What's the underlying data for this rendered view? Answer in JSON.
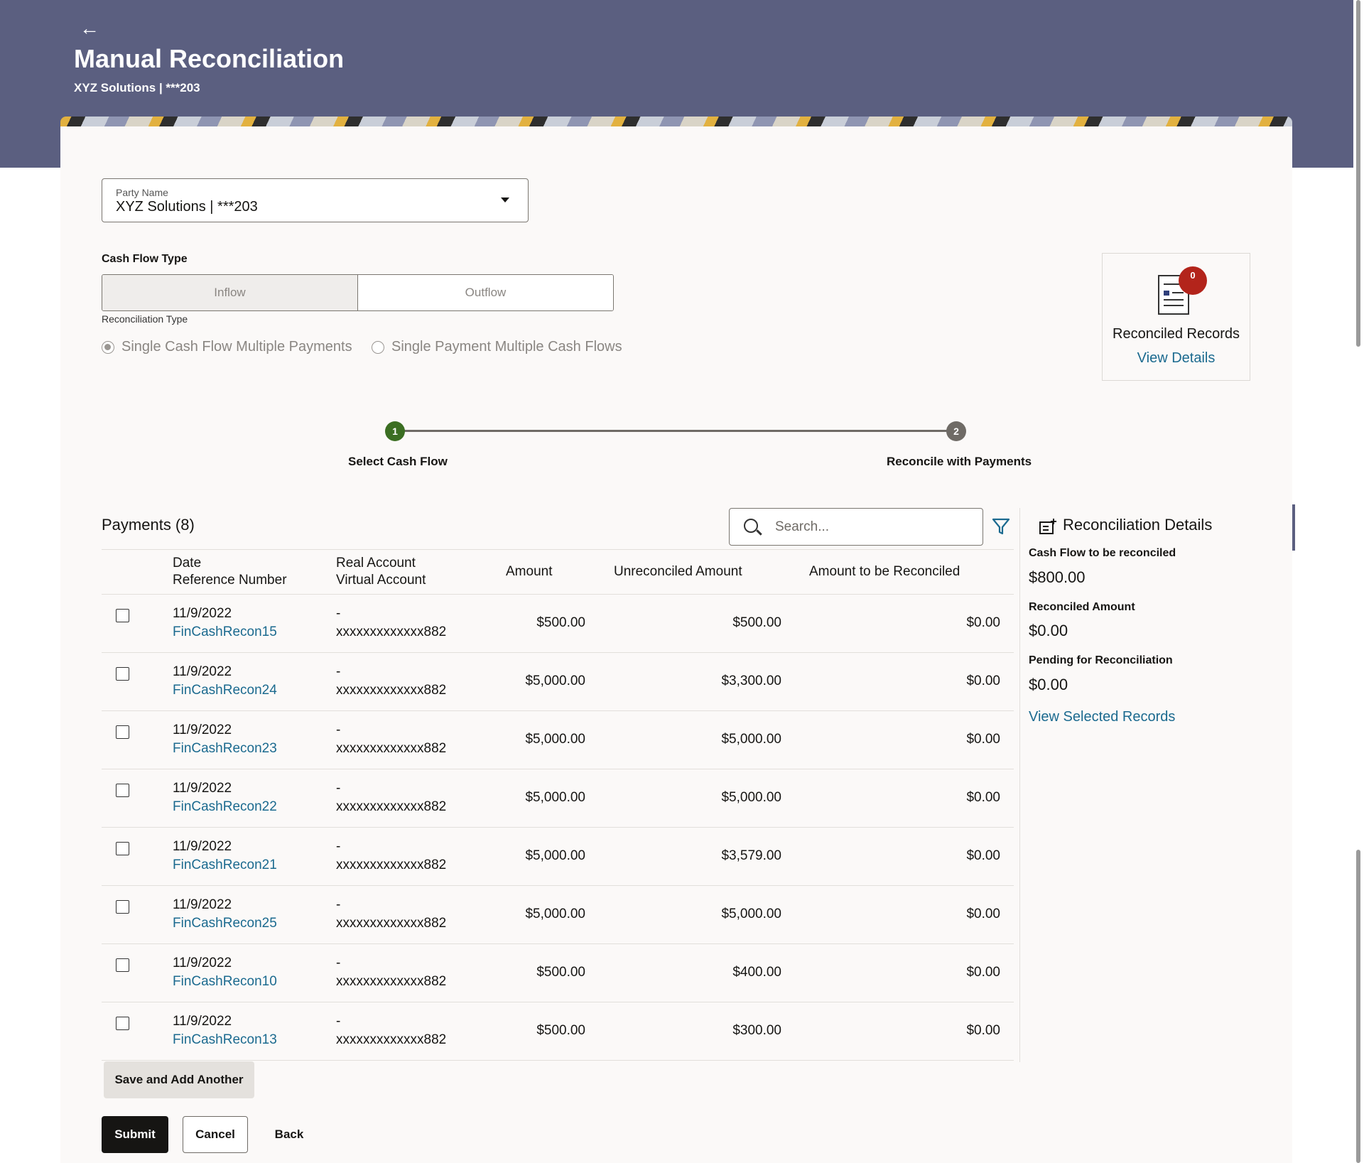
{
  "header": {
    "title": "Manual Reconciliation",
    "subtitle": "XYZ Solutions | ***203",
    "back_icon": "arrow-left-icon"
  },
  "party": {
    "label": "Party Name",
    "value": "XYZ Solutions | ***203"
  },
  "cash_flow_type": {
    "label": "Cash Flow Type",
    "options": [
      "Inflow",
      "Outflow"
    ],
    "selected": "Inflow"
  },
  "reconciliation_type": {
    "label": "Reconciliation Type",
    "options": [
      "Single Cash Flow Multiple Payments",
      "Single Payment Multiple Cash Flows"
    ],
    "selected": "Single Cash Flow Multiple Payments"
  },
  "reconciled_records": {
    "count": "0",
    "title": "Reconciled Records",
    "link": "View Details"
  },
  "stepper": {
    "steps": [
      {
        "number": "1",
        "label": "Select Cash Flow"
      },
      {
        "number": "2",
        "label": "Reconcile with Payments"
      }
    ],
    "active_color": "#3b6e22",
    "inactive_color": "#6f6b66"
  },
  "payments": {
    "title": "Payments (8)",
    "search_placeholder": "Search...",
    "columns": {
      "date": "Date",
      "reference": "Reference Number",
      "real_account": "Real Account",
      "virtual_account": "Virtual Account",
      "amount": "Amount",
      "unreconciled": "Unreconciled Amount",
      "to_be_reconciled": "Amount to be Reconciled"
    },
    "rows": [
      {
        "date": "11/9/2022",
        "ref": "FinCashRecon15",
        "real": "-",
        "virtual": "xxxxxxxxxxxxx882",
        "amount": "$500.00",
        "unreconciled": "$500.00",
        "to_reconcile": "$0.00"
      },
      {
        "date": "11/9/2022",
        "ref": "FinCashRecon24",
        "real": "-",
        "virtual": "xxxxxxxxxxxxx882",
        "amount": "$5,000.00",
        "unreconciled": "$3,300.00",
        "to_reconcile": "$0.00"
      },
      {
        "date": "11/9/2022",
        "ref": "FinCashRecon23",
        "real": "-",
        "virtual": "xxxxxxxxxxxxx882",
        "amount": "$5,000.00",
        "unreconciled": "$5,000.00",
        "to_reconcile": "$0.00"
      },
      {
        "date": "11/9/2022",
        "ref": "FinCashRecon22",
        "real": "-",
        "virtual": "xxxxxxxxxxxxx882",
        "amount": "$5,000.00",
        "unreconciled": "$5,000.00",
        "to_reconcile": "$0.00"
      },
      {
        "date": "11/9/2022",
        "ref": "FinCashRecon21",
        "real": "-",
        "virtual": "xxxxxxxxxxxxx882",
        "amount": "$5,000.00",
        "unreconciled": "$3,579.00",
        "to_reconcile": "$0.00"
      },
      {
        "date": "11/9/2022",
        "ref": "FinCashRecon25",
        "real": "-",
        "virtual": "xxxxxxxxxxxxx882",
        "amount": "$5,000.00",
        "unreconciled": "$5,000.00",
        "to_reconcile": "$0.00"
      },
      {
        "date": "11/9/2022",
        "ref": "FinCashRecon10",
        "real": "-",
        "virtual": "xxxxxxxxxxxxx882",
        "amount": "$500.00",
        "unreconciled": "$400.00",
        "to_reconcile": "$0.00"
      },
      {
        "date": "11/9/2022",
        "ref": "FinCashRecon13",
        "real": "-",
        "virtual": "xxxxxxxxxxxxx882",
        "amount": "$500.00",
        "unreconciled": "$300.00",
        "to_reconcile": "$0.00"
      }
    ]
  },
  "details": {
    "title": "Reconciliation Details",
    "cash_flow_label": "Cash Flow to be reconciled",
    "cash_flow_value": "$800.00",
    "reconciled_label": "Reconciled Amount",
    "reconciled_value": "$0.00",
    "pending_label": "Pending for Reconciliation",
    "pending_value": "$0.00",
    "view_selected": "View Selected Records"
  },
  "actions": {
    "save_add": "Save and Add Another",
    "submit": "Submit",
    "cancel": "Cancel",
    "back": "Back"
  },
  "colors": {
    "header_bg": "#5b5f80",
    "link": "#1b6a8f",
    "badge": "#b3241b",
    "primary_button": "#161513",
    "filter_icon": "#1b6a8f"
  }
}
